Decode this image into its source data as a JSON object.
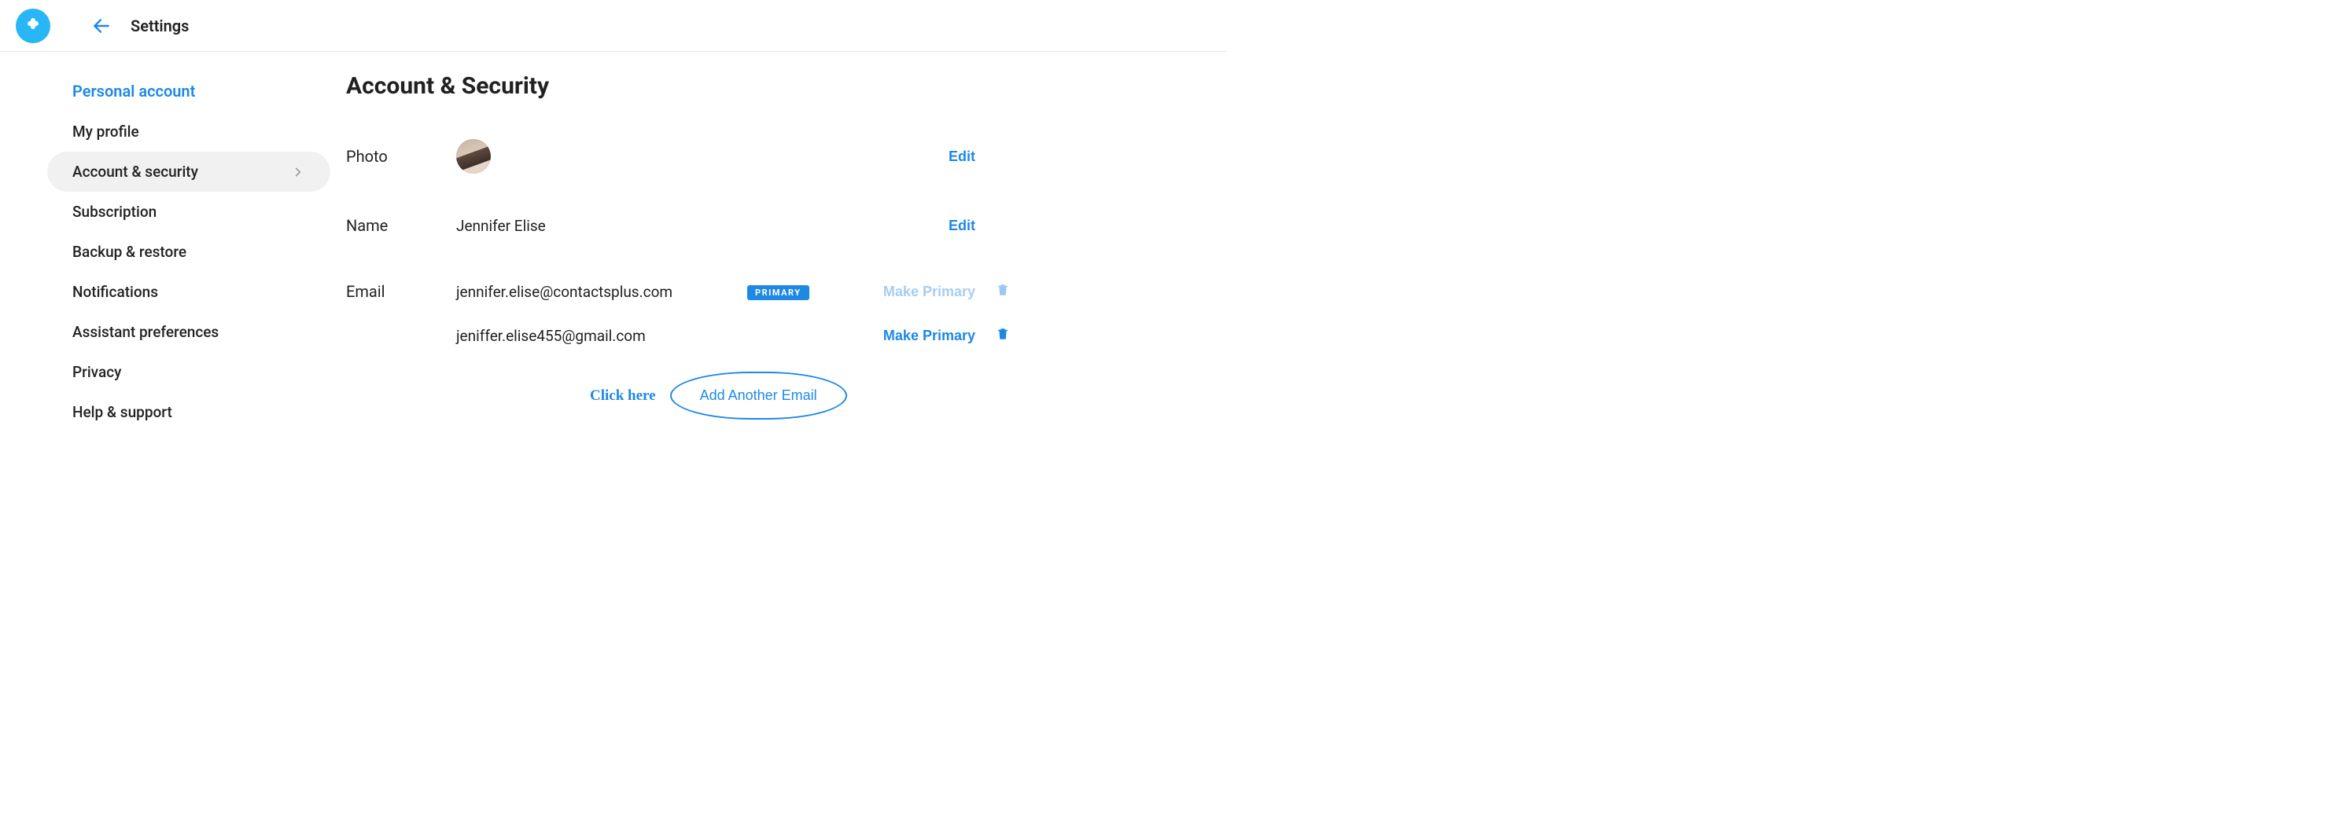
{
  "topbar": {
    "page": "Settings"
  },
  "sidebar": {
    "toplink": "Personal account",
    "items": [
      {
        "label": "My profile",
        "active": false
      },
      {
        "label": "Account & security",
        "active": true
      },
      {
        "label": "Subscription",
        "active": false
      },
      {
        "label": "Backup & restore",
        "active": false
      },
      {
        "label": "Notifications",
        "active": false
      },
      {
        "label": "Assistant preferences",
        "active": false
      },
      {
        "label": "Privacy",
        "active": false
      },
      {
        "label": "Help & support",
        "active": false
      }
    ]
  },
  "main": {
    "title": "Account & Security",
    "photo": {
      "label": "Photo",
      "edit": "Edit"
    },
    "name": {
      "label": "Name",
      "value": "Jennifer Elise",
      "edit": "Edit"
    },
    "email": {
      "label": "Email",
      "primary_badge": "PRIMARY",
      "make_primary": "Make Primary",
      "items": [
        {
          "address": "jennifer.elise@contactsplus.com",
          "primary": true
        },
        {
          "address": "jeniffer.elise455@gmail.com",
          "primary": false
        }
      ],
      "add_label": "Add Another Email"
    }
  },
  "annotation": {
    "click_here": "Click here"
  },
  "colors": {
    "accent": "#1e88e5",
    "logo_bg": "#29b6f6"
  }
}
